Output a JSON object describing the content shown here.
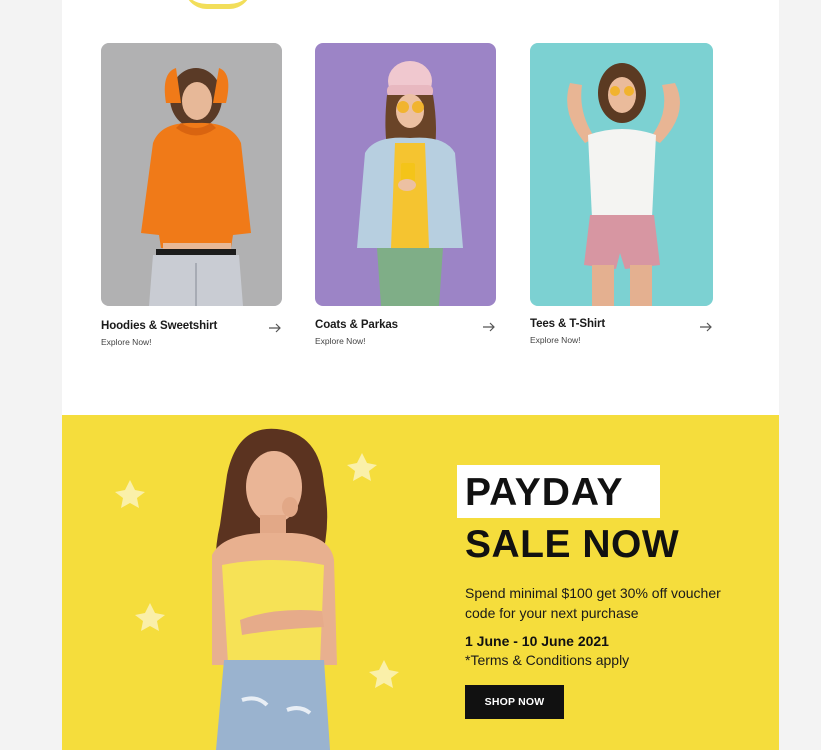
{
  "categories": [
    {
      "title": "Hoodies & Sweetshirt",
      "subtitle": "Explore Now!"
    },
    {
      "title": "Coats & Parkas",
      "subtitle": "Explore Now!"
    },
    {
      "title": "Tees & T-Shirt",
      "subtitle": "Explore Now!"
    }
  ],
  "promo": {
    "heading_line1": "PAYDAY",
    "heading_line2": "SALE NOW",
    "description": "Spend minimal $100 get 30% off voucher code for your next purchase",
    "date_range": "1 June - 10 June 2021",
    "terms": "*Terms & Conditions apply",
    "cta_label": "SHOP NOW"
  },
  "colors": {
    "banner_yellow": "#f5dd3c",
    "card1_bg": "#a9a9ab",
    "card2_bg": "#9c84c6",
    "card3_bg": "#86d3d3",
    "button_black": "#111111"
  }
}
